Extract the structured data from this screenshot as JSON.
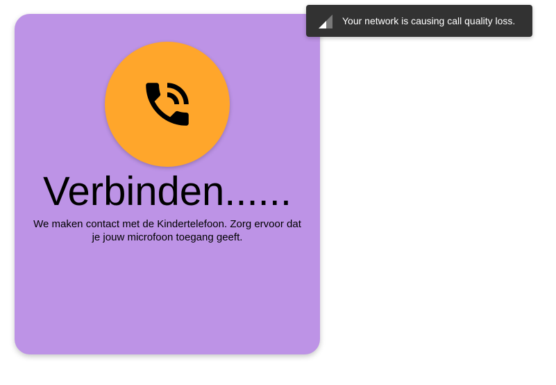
{
  "call": {
    "status_title": "Verbinden......",
    "status_text": "We maken contact met de Kindertelefoon. Zorg ervoor dat je jouw microfoon toegang geeft.",
    "icon": "phone-in-talk-icon"
  },
  "notification": {
    "message": "Your network is causing call quality loss.",
    "icon": "weak-signal-icon"
  },
  "colors": {
    "card_background": "#bd93e6",
    "avatar_background": "#ffa62b",
    "toast_background": "#323232",
    "text": "#000000",
    "toast_text": "#ffffff"
  }
}
